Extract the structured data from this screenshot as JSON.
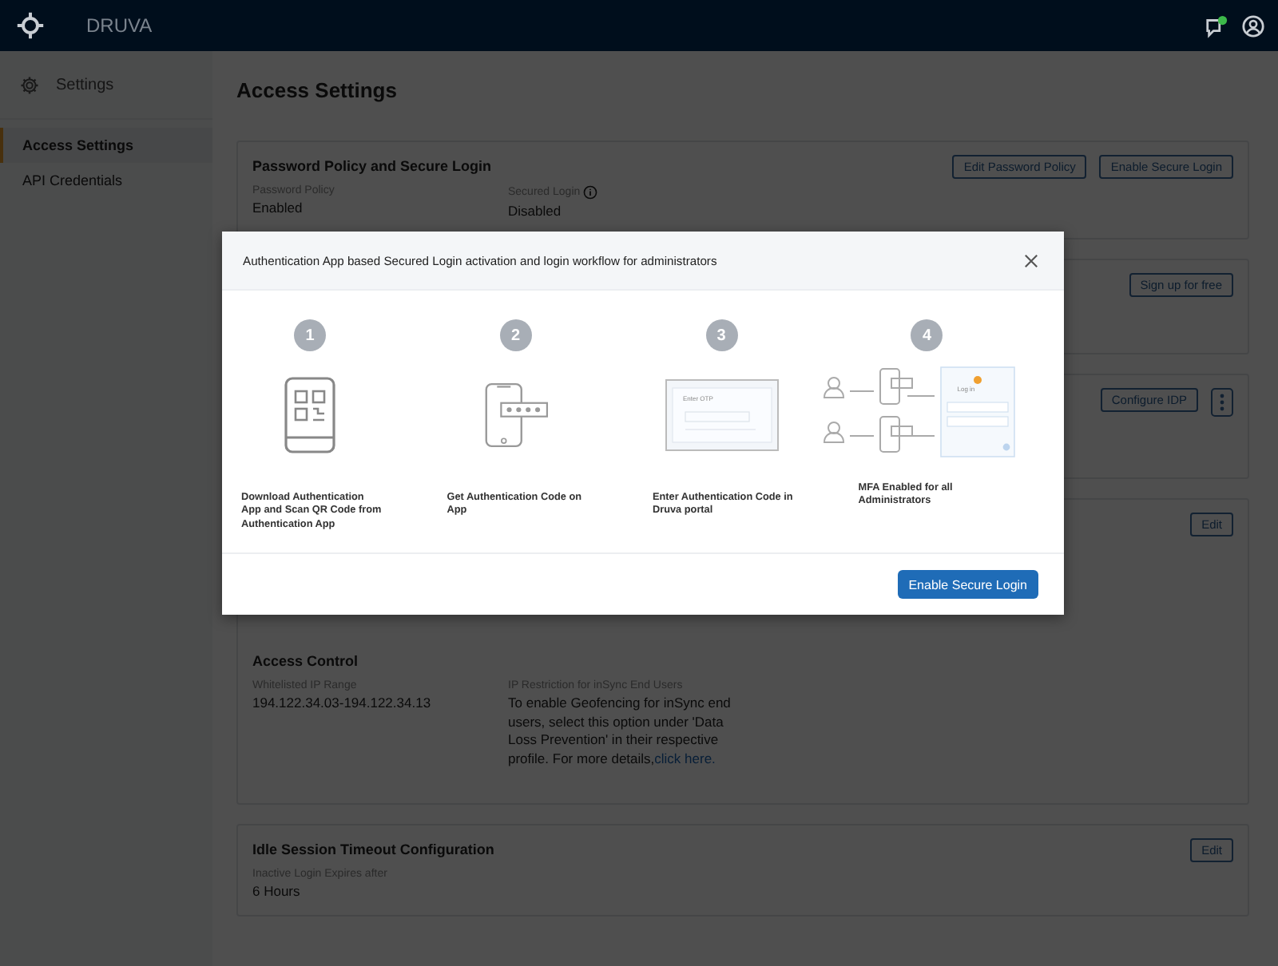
{
  "app": {
    "brand": "DRUVA",
    "notification_dot": true
  },
  "sidebar": {
    "title": "Settings",
    "items": [
      {
        "label": "Access Settings",
        "selected": true
      },
      {
        "label": "API Credentials",
        "selected": false
      }
    ]
  },
  "page_title": "Access Settings",
  "cards": [
    {
      "kind": "top",
      "title": "Password Policy and Secure Login",
      "buttons": [
        "Edit Password Policy",
        "Enable Secure Login"
      ],
      "fields": [
        {
          "label": "Password Policy",
          "value": "Enabled"
        },
        {
          "label": "Secured Login",
          "value": "Disabled",
          "info": true
        }
      ]
    },
    {
      "kind": "top",
      "buttons": [
        "Sign up for free"
      ]
    },
    {
      "kind": "top",
      "buttons": [
        "Configure IDP"
      ],
      "more_menu": true
    },
    {
      "kind": "bottom",
      "title": "Access Control",
      "buttons": [
        "Edit"
      ],
      "fields": [
        {
          "label": "Whitelisted IP Range",
          "value": "194.122.34.03-194.122.34.13"
        },
        {
          "label": "IP Restriction for inSync End Users",
          "value": "To enable Geofencing for inSync end users, select this option under 'Data Loss Prevention' in their respective profile. For more details,",
          "link": "click here."
        }
      ]
    },
    {
      "kind": "top",
      "title": "Idle Session Timeout  Configuration",
      "buttons": [
        "Edit"
      ],
      "fields": [
        {
          "label": "Inactive Login Expires after",
          "value": "6 Hours"
        }
      ]
    }
  ],
  "modal": {
    "title": "Authentication App based Secured Login activation and login workflow for administrators",
    "steps": [
      {
        "number": "1",
        "kind": "qr",
        "caption": "Download Authentication App and  Scan QR Code from Authentication App"
      },
      {
        "number": "2",
        "kind": "code",
        "caption": "Get Authentication Code on App"
      },
      {
        "number": "3",
        "kind": "portal",
        "caption": "Enter Authentication Code in Druva portal",
        "screen_label": "Enter OTP"
      },
      {
        "number": "4",
        "kind": "mfa",
        "caption": "MFA Enabled for all Administrators",
        "screen_label": "Log in"
      }
    ],
    "button": "Enable Secure Login"
  }
}
